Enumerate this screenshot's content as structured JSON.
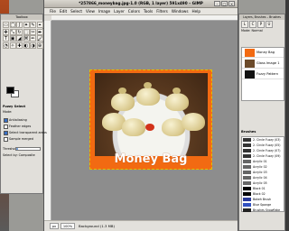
{
  "window": {
    "title": "*257866_moneybag.jpg-1.0 (RGB, 1 layer) 591x490 – GIMP",
    "close": "×",
    "maximize": "□",
    "minimize": "–"
  },
  "menu": [
    "File",
    "Edit",
    "Select",
    "View",
    "Image",
    "Layer",
    "Colors",
    "Tools",
    "Filters",
    "Windows",
    "Help"
  ],
  "image": {
    "caption": "Money Bag"
  },
  "status": {
    "unit": "px",
    "zoom": "100%",
    "text": "Background (1.3 MB)"
  },
  "toolbox": {
    "title": "Toolbox",
    "tools": [
      "▭",
      "◯",
      "ʃ",
      "✦",
      "✎",
      "⌖",
      "✥",
      "⤡",
      "↻",
      "⬚",
      "✂",
      "⬌",
      "T",
      "▣",
      "◢",
      "⌘",
      "✏",
      "🖌",
      "◔",
      "✧",
      "✚",
      "◐",
      "◑",
      "⊕"
    ],
    "options_title": "Fuzzy Select",
    "mode_label": "Mode:",
    "options": [
      {
        "label": "Antialiasing",
        "checked": true
      },
      {
        "label": "Feather edges",
        "checked": false
      },
      {
        "label": "Select transparent areas",
        "checked": true
      },
      {
        "label": "Sample merged",
        "checked": false
      }
    ],
    "threshold_label": "Threshold",
    "threshold_value": 15,
    "threshold_max": 255,
    "fill_by": "Select by: Composite"
  },
  "dock": {
    "title": "Layers, Brushes – Brushes",
    "tabs": [
      "L",
      "C",
      "P",
      "U"
    ],
    "mode_label": "Mode: Normal",
    "layers": [
      {
        "name": "Money Bag",
        "thumb_color": "#f26a12"
      },
      {
        "name": "Glass Image 1",
        "thumb_color": "#6b4a2a"
      },
      {
        "name": "Fuzzy Pattern",
        "thumb_color": "#111111"
      }
    ],
    "brushes_label": "Brushes",
    "brushes": [
      {
        "name": "2. Circle Fuzzy (03)",
        "color": "#333"
      },
      {
        "name": "2. Circle Fuzzy (05)",
        "color": "#333"
      },
      {
        "name": "2. Circle Fuzzy (07)",
        "color": "#333"
      },
      {
        "name": "2. Circle Fuzzy (09)",
        "color": "#333"
      },
      {
        "name": "Acrylic 01",
        "color": "#666"
      },
      {
        "name": "Acrylic 02",
        "color": "#666"
      },
      {
        "name": "Acrylic 03",
        "color": "#666"
      },
      {
        "name": "Acrylic 04",
        "color": "#666"
      },
      {
        "name": "Acrylic 05",
        "color": "#666"
      },
      {
        "name": "Block 01",
        "color": "#000"
      },
      {
        "name": "Block 02",
        "color": "#000"
      },
      {
        "name": "Bokeh Brush",
        "color": "#2a3a9a"
      },
      {
        "name": "Blue Sponge",
        "color": "#3050c0"
      },
      {
        "name": "Brushes Snowflake",
        "color": "#222"
      }
    ]
  }
}
